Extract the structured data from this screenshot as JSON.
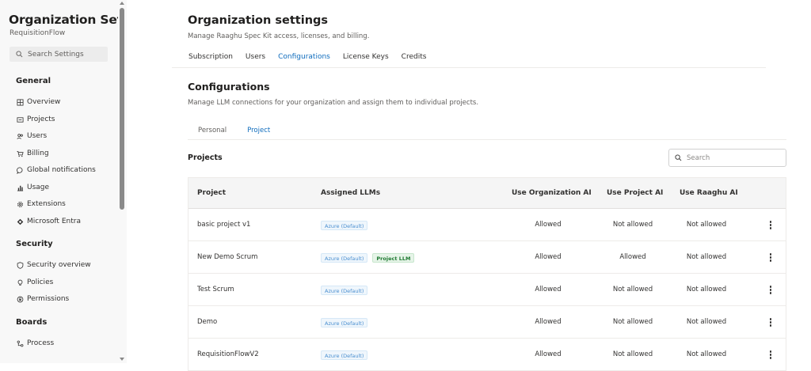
{
  "sidebar": {
    "title": "Organization Settin...",
    "org_name": "RequisitionFlow",
    "search_placeholder": "Search Settings",
    "sections": [
      {
        "label": "General",
        "items": [
          {
            "label": "Overview",
            "icon": "grid-icon"
          },
          {
            "label": "Projects",
            "icon": "projects-icon"
          },
          {
            "label": "Users",
            "icon": "users-icon"
          },
          {
            "label": "Billing",
            "icon": "cart-icon"
          },
          {
            "label": "Global notifications",
            "icon": "chat-icon"
          },
          {
            "label": "Usage",
            "icon": "chart-icon"
          },
          {
            "label": "Extensions",
            "icon": "gear-icon"
          },
          {
            "label": "Microsoft Entra",
            "icon": "diamond-icon"
          }
        ]
      },
      {
        "label": "Security",
        "items": [
          {
            "label": "Security overview",
            "icon": "shield-icon"
          },
          {
            "label": "Policies",
            "icon": "bulb-icon"
          },
          {
            "label": "Permissions",
            "icon": "lock-icon"
          }
        ]
      },
      {
        "label": "Boards",
        "items": [
          {
            "label": "Process",
            "icon": "process-icon"
          }
        ]
      }
    ]
  },
  "header": {
    "title": "Organization settings",
    "subtitle": "Manage Raaghu Spec Kit access, licenses, and billing.",
    "tabs": [
      "Subscription",
      "Users",
      "Configurations",
      "License Keys",
      "Credits"
    ],
    "active_tab": "Configurations"
  },
  "configurations": {
    "title": "Configurations",
    "subtitle": "Manage LLM connections for your organization and assign them to individual projects.",
    "tabs": [
      "Personal",
      "Project"
    ],
    "active_tab": "Project",
    "projects_label": "Projects",
    "search_placeholder": "Search"
  },
  "table": {
    "columns": [
      "Project",
      "Assigned LLMs",
      "Use Organization AI",
      "Use Project AI",
      "Use Raaghu AI"
    ],
    "rows": [
      {
        "project": "basic project v1",
        "llms": [
          "Azure (Default)"
        ],
        "org_ai": "Allowed",
        "project_ai": "Not allowed",
        "raaghu_ai": "Not allowed"
      },
      {
        "project": "New Demo Scrum",
        "llms": [
          "Azure (Default)",
          "Project LLM"
        ],
        "org_ai": "Allowed",
        "project_ai": "Allowed",
        "raaghu_ai": "Not allowed"
      },
      {
        "project": "Test Scrum",
        "llms": [
          "Azure (Default)"
        ],
        "org_ai": "Allowed",
        "project_ai": "Not allowed",
        "raaghu_ai": "Not allowed"
      },
      {
        "project": "Demo",
        "llms": [
          "Azure (Default)"
        ],
        "org_ai": "Allowed",
        "project_ai": "Not allowed",
        "raaghu_ai": "Not allowed"
      },
      {
        "project": "RequisitionFlowV2",
        "llms": [
          "Azure (Default)"
        ],
        "org_ai": "Allowed",
        "project_ai": "Not allowed",
        "raaghu_ai": "Not allowed"
      }
    ]
  },
  "colors": {
    "accent": "#0f6cbd",
    "sidebar_bg": "#f8f8f8",
    "tag_default": "#4a8fd0",
    "tag_project": "#1f7a32"
  }
}
